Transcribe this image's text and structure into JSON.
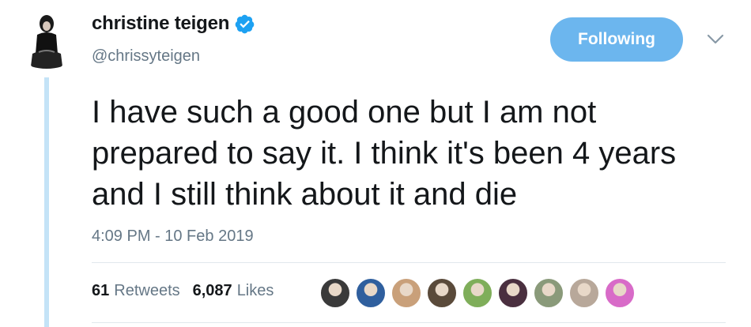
{
  "author": {
    "display_name": "christine teigen",
    "handle": "@chrissyteigen",
    "verified": true,
    "avatar_icon": "profile-photo"
  },
  "follow_button": {
    "label": "Following"
  },
  "menu_icon": "chevron-down-icon",
  "tweet": {
    "text": "I have such a good one but I am not prepared to say it. I think it's been 4 years and I still think about it and die",
    "timestamp": "4:09 PM - 10 Feb 2019"
  },
  "stats": {
    "retweets_count": "61",
    "retweets_label": "Retweets",
    "likes_count": "6,087",
    "likes_label": "Likes"
  },
  "likers": [
    {
      "icon": "liker-avatar",
      "color": "#3a3a3a"
    },
    {
      "icon": "liker-avatar",
      "color": "#2f5f9e"
    },
    {
      "icon": "liker-avatar",
      "color": "#c9a07a"
    },
    {
      "icon": "liker-avatar",
      "color": "#5a4a3a"
    },
    {
      "icon": "liker-avatar",
      "color": "#7fae5a"
    },
    {
      "icon": "liker-avatar",
      "color": "#4a2f3f"
    },
    {
      "icon": "liker-avatar",
      "color": "#8a9a7a"
    },
    {
      "icon": "liker-avatar",
      "color": "#b8a89a"
    },
    {
      "icon": "liker-avatar",
      "color": "#d86bc8"
    }
  ],
  "colors": {
    "brand_blue": "#1da1f2",
    "following_button": "#6cb6ee",
    "thread_line": "#c4e3f7",
    "secondary_text": "#657786"
  }
}
